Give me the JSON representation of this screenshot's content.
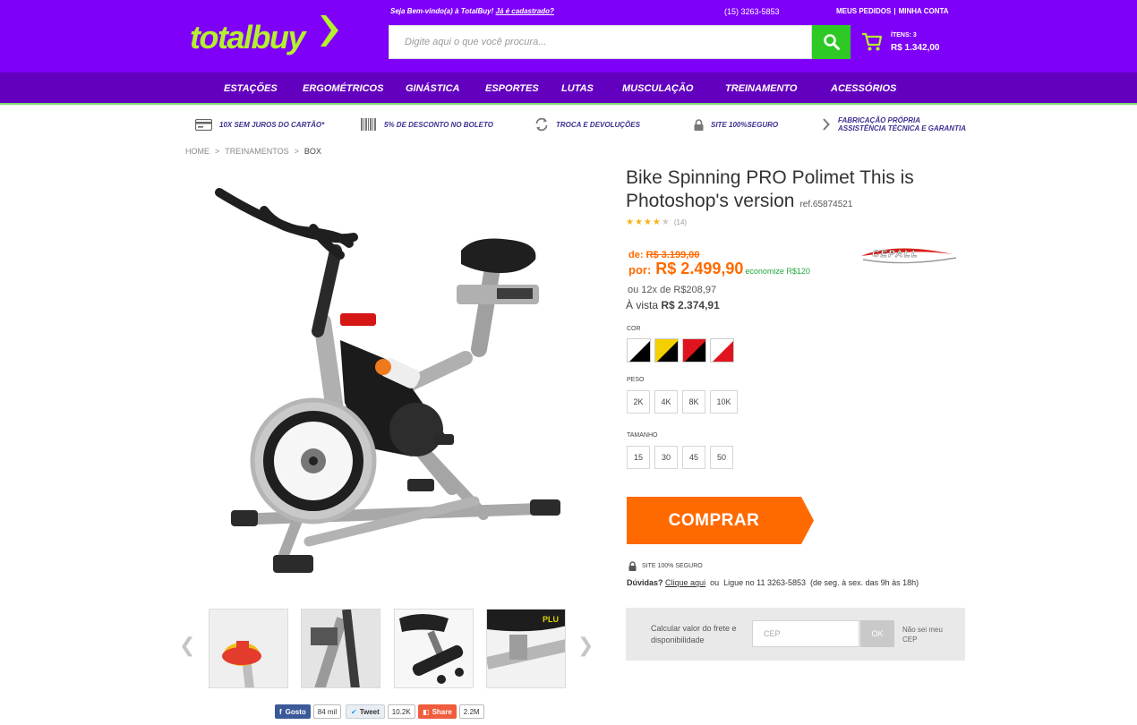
{
  "header": {
    "logo_text": "totalbuy",
    "welcome_text": "Seja Bem-vindo(a) à TotalBuy!",
    "welcome_link": "Já é cadastrado?",
    "phone": "(15) 3263-5853",
    "my_orders": "MEUS PEDIDOS",
    "separator": "|",
    "my_account": "MINHA CONTA",
    "search_placeholder": "Digite aqui o que você procura...",
    "cart_items": "ÍTENS: 3",
    "cart_total": "R$ 1.342,00"
  },
  "nav": {
    "items": [
      "ESTAÇÕES",
      "ERGOMÉTRICOS",
      "GINÁSTICA",
      "ESPORTES",
      "LUTAS",
      "MUSCULAÇÃO",
      "TREINAMENTO",
      "ACESSÓRIOS"
    ]
  },
  "benefits": [
    {
      "text": "10X SEM JUROS DO CARTÃO*",
      "icon": "credit-card-icon"
    },
    {
      "text": "5% DE DESCONTO NO BOLETO",
      "icon": "barcode-icon"
    },
    {
      "text": "TROCA E DEVOLUÇÕES",
      "icon": "exchange-icon"
    },
    {
      "text": "SITE 100%SEGURO",
      "icon": "lock-icon"
    },
    {
      "text_line1": "FABRICAÇÃO PRÓPRIA",
      "text_line2": "ASSISTÊNCIA TÉCNICA E GARANTIA",
      "icon": "chevron-right-icon"
    }
  ],
  "breadcrumb": {
    "items": [
      "HOME",
      "TREINAMENTOS",
      "BOX"
    ],
    "separator": ">"
  },
  "product": {
    "title": "Bike Spinning PRO Polimet This is Photoshop's version",
    "ref": "ref.65874521",
    "rating": 4,
    "rating_max": 5,
    "rating_count": "(14)",
    "brand": "CEPALL",
    "old_price_prefix": "de:",
    "old_price": "R$ 3.199,00",
    "new_price_prefix": "por:",
    "new_price": "R$ 2.499,90",
    "economize": "economize R$120",
    "installments": "ou 12x de R$208,97",
    "avista_label": "À vista",
    "avista_price": "R$ 2.374,91"
  },
  "options": {
    "color_label": "COR",
    "colors": [
      {
        "name": "black",
        "primary": "#000000",
        "secondary": "#ffffff"
      },
      {
        "name": "yellow",
        "primary": "#f5d000",
        "secondary": "#000000"
      },
      {
        "name": "red",
        "primary": "#e0141e",
        "secondary": "#000000"
      },
      {
        "name": "white-red",
        "primary": "#e0141e",
        "secondary": "#ffffff"
      }
    ],
    "weight_label": "PESO",
    "weights": [
      "2K",
      "4K",
      "8K",
      "10K"
    ],
    "size_label": "TAMANHO",
    "sizes": [
      "15",
      "30",
      "45",
      "50"
    ]
  },
  "actions": {
    "buy_label": "COMPRAR",
    "secure_text": "SITE 100% SEGURO",
    "doubts_label": "Dúvidas?",
    "doubts_link": "Clique aqui",
    "doubts_or": "ou",
    "doubts_phone": "Ligue no 11 3263-5853",
    "doubts_hours": "(de seg. à sex. das 9h às 18h)"
  },
  "freight": {
    "label": "Calcular valor do frete e disponibilidade",
    "cep_placeholder": "CEP",
    "ok_label": "OK",
    "unknown_cep": "Não sei meu CEP"
  },
  "social": {
    "facebook_label": "Gosto",
    "facebook_count": "84 mil",
    "twitter_label": "Tweet",
    "twitter_count": "10.2K",
    "share_label": "Share",
    "share_count": "2.2M"
  },
  "colors": {
    "header_bg": "#7f00f8",
    "nav_bg": "#6300bf",
    "logo_green": "#b5f02e",
    "search_green": "#2ec925",
    "price_orange": "#ff6a00",
    "buy_orange": "#ff6a00"
  }
}
